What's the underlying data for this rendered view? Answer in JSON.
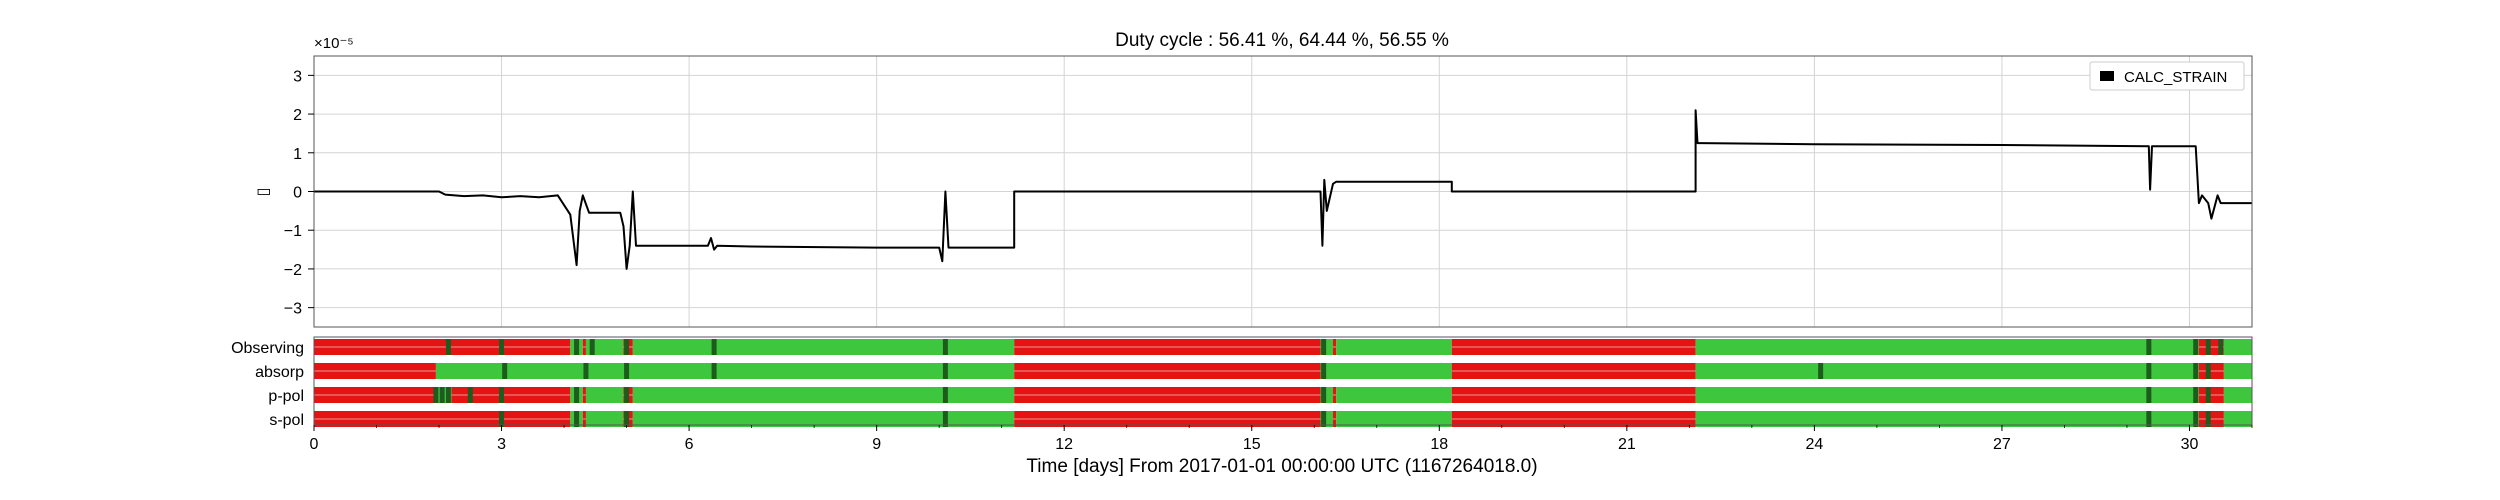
{
  "chart_data": {
    "type": "line",
    "title": "Duty cycle : 56.41 %, 64.44 %, 56.55 %",
    "xlabel": "Time [days] From 2017-01-01 00:00:00 UTC (1167264018.0)",
    "ylabel": "▯",
    "y_multiplier": "×10⁻⁵",
    "xlim": [
      0,
      31
    ],
    "ylim": [
      -3.5,
      3.5
    ],
    "grid": true,
    "legend_position": "top-right",
    "x_ticks": [
      "0",
      "3",
      "6",
      "9",
      "12",
      "15",
      "18",
      "21",
      "24",
      "27",
      "30"
    ],
    "y_ticks": [
      "−3",
      "−2",
      "−1",
      "0",
      "1",
      "2",
      "3"
    ],
    "series": [
      {
        "name": "CALC_STRAIN",
        "color": "#000000",
        "x": [
          0,
          2.0,
          2.1,
          2.4,
          2.7,
          3.0,
          3.3,
          3.6,
          3.9,
          4.1,
          4.2,
          4.25,
          4.3,
          4.4,
          4.5,
          4.9,
          4.95,
          5.0,
          5.05,
          5.1,
          5.15,
          5.2,
          6.3,
          6.35,
          6.4,
          6.45,
          7.0,
          9.0,
          10.0,
          10.05,
          10.1,
          10.15,
          10.2,
          11.2,
          11.2,
          16.1,
          16.13,
          16.16,
          16.2,
          16.3,
          16.35,
          16.4,
          18.2,
          18.2,
          22.1,
          22.1,
          22.13,
          22.16,
          22.2,
          24.0,
          27.0,
          29.35,
          29.37,
          29.4,
          30.1,
          30.15,
          30.2,
          30.3,
          30.35,
          30.45,
          30.5,
          30.6,
          31.0
        ],
        "y": [
          0,
          0,
          -0.08,
          -0.12,
          -0.1,
          -0.15,
          -0.12,
          -0.15,
          -0.1,
          -0.6,
          -1.9,
          -0.5,
          -0.1,
          -0.55,
          -0.55,
          -0.55,
          -0.9,
          -2.0,
          -1.4,
          0,
          -1.4,
          -1.4,
          -1.4,
          -1.2,
          -1.5,
          -1.4,
          -1.42,
          -1.45,
          -1.45,
          -1.8,
          0,
          -1.45,
          -1.45,
          -1.45,
          0,
          0,
          -1.4,
          0.3,
          -0.5,
          0.2,
          0.25,
          0.25,
          0.25,
          0,
          0,
          2.1,
          1.25,
          1.25,
          1.25,
          1.22,
          1.2,
          1.17,
          0.05,
          1.17,
          1.17,
          -0.3,
          -0.1,
          -0.3,
          -0.7,
          -0.1,
          -0.3,
          -0.3,
          -0.3
        ]
      }
    ],
    "state_panel": {
      "active_color": "#3ec63e",
      "inactive_color": "#e41414",
      "marker_color": "#1e5c1e",
      "rows": [
        {
          "label": "Observing",
          "segments": [
            [
              0,
              4.1,
              false
            ],
            [
              4.1,
              4.3,
              true
            ],
            [
              4.3,
              4.35,
              false
            ],
            [
              4.35,
              4.95,
              true
            ],
            [
              4.95,
              5.1,
              false
            ],
            [
              5.1,
              11.2,
              true
            ],
            [
              11.2,
              16.1,
              false
            ],
            [
              16.1,
              16.3,
              true
            ],
            [
              16.3,
              16.35,
              false
            ],
            [
              16.35,
              18.2,
              true
            ],
            [
              18.2,
              22.1,
              false
            ],
            [
              22.1,
              30.15,
              true
            ],
            [
              30.15,
              30.55,
              false
            ],
            [
              30.55,
              31.0,
              true
            ]
          ],
          "markers": [
            2.15,
            3.0,
            4.2,
            4.45,
            5.0,
            6.4,
            10.1,
            16.15,
            29.35,
            30.1,
            30.3,
            30.5
          ]
        },
        {
          "label": "absorp",
          "segments": [
            [
              0,
              1.95,
              false
            ],
            [
              1.95,
              11.2,
              true
            ],
            [
              11.2,
              16.1,
              false
            ],
            [
              16.1,
              18.2,
              true
            ],
            [
              18.2,
              22.1,
              false
            ],
            [
              22.1,
              30.15,
              true
            ],
            [
              30.15,
              30.55,
              false
            ],
            [
              30.55,
              31.0,
              true
            ]
          ],
          "markers": [
            3.05,
            4.35,
            5.0,
            6.4,
            10.1,
            16.15,
            24.1,
            29.35,
            30.1,
            30.3
          ]
        },
        {
          "label": "p-pol",
          "segments": [
            [
              0,
              1.95,
              false
            ],
            [
              1.95,
              2.2,
              true
            ],
            [
              2.2,
              4.1,
              false
            ],
            [
              4.1,
              4.3,
              true
            ],
            [
              4.3,
              4.35,
              false
            ],
            [
              4.35,
              4.95,
              true
            ],
            [
              4.95,
              5.1,
              false
            ],
            [
              5.1,
              11.2,
              true
            ],
            [
              11.2,
              16.1,
              false
            ],
            [
              16.1,
              16.3,
              true
            ],
            [
              16.3,
              16.35,
              false
            ],
            [
              16.35,
              18.2,
              true
            ],
            [
              18.2,
              22.1,
              false
            ],
            [
              22.1,
              30.15,
              true
            ],
            [
              30.15,
              30.55,
              false
            ],
            [
              30.55,
              31.0,
              true
            ]
          ],
          "markers": [
            1.95,
            2.05,
            2.15,
            2.5,
            3.0,
            4.2,
            5.0,
            10.1,
            16.15,
            29.35,
            30.1,
            30.3
          ]
        },
        {
          "label": "s-pol",
          "segments": [
            [
              0,
              4.1,
              false
            ],
            [
              4.1,
              4.3,
              true
            ],
            [
              4.3,
              4.35,
              false
            ],
            [
              4.35,
              4.95,
              true
            ],
            [
              4.95,
              5.1,
              false
            ],
            [
              5.1,
              11.2,
              true
            ],
            [
              11.2,
              16.1,
              false
            ],
            [
              16.1,
              16.3,
              true
            ],
            [
              16.3,
              16.35,
              false
            ],
            [
              16.35,
              18.2,
              true
            ],
            [
              18.2,
              22.1,
              false
            ],
            [
              22.1,
              30.15,
              true
            ],
            [
              30.15,
              30.55,
              false
            ],
            [
              30.55,
              31.0,
              true
            ]
          ],
          "markers": [
            3.0,
            4.2,
            5.0,
            10.1,
            16.15,
            29.35,
            30.1,
            30.3
          ]
        }
      ]
    }
  }
}
